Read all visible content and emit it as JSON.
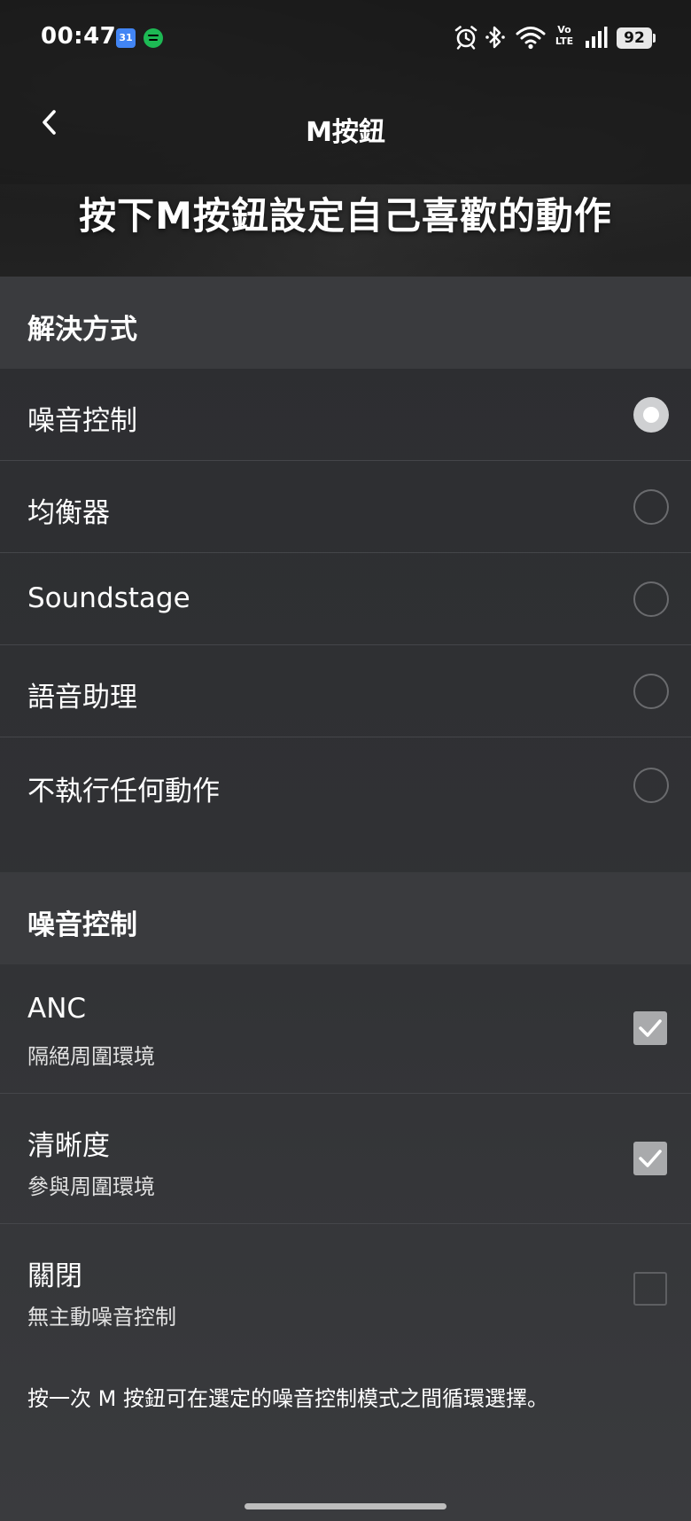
{
  "status_bar": {
    "time": "00:47",
    "calendar_badge": "31",
    "battery_level": "92",
    "volte_label_top": "Vo",
    "volte_label_bottom": "LTE"
  },
  "nav": {
    "title": "M按鈕"
  },
  "hero": {
    "title": "按下M按鈕設定自己喜歡的動作"
  },
  "solutions": {
    "header": "解決方式",
    "options": [
      {
        "label": "噪音控制",
        "selected": true
      },
      {
        "label": "均衡器",
        "selected": false
      },
      {
        "label": "Soundstage",
        "selected": false
      },
      {
        "label": "語音助理",
        "selected": false
      },
      {
        "label": "不執行任何動作",
        "selected": false
      }
    ]
  },
  "noise_control": {
    "header": "噪音控制",
    "modes": [
      {
        "title": "ANC",
        "subtitle": "隔絕周圍環境",
        "checked": true
      },
      {
        "title": "清晰度",
        "subtitle": "參與周圍環境",
        "checked": true
      },
      {
        "title": "關閉",
        "subtitle": "無主動噪音控制",
        "checked": false
      }
    ],
    "footnote": "按一次 M 按鈕可在選定的噪音控制模式之間循環選擇。"
  },
  "icons": {
    "back": "chevron-left-icon",
    "alarm": "alarm-icon",
    "bluetooth": "bluetooth-icon",
    "wifi": "wifi-icon",
    "signal": "signal-icon",
    "battery": "battery-icon",
    "check": "check-icon"
  },
  "colors": {
    "background": "#2f3033",
    "section_header": "#3a3b3e",
    "radio_selected": "#cfd0d2",
    "checkbox_checked": "#a9aaac"
  }
}
